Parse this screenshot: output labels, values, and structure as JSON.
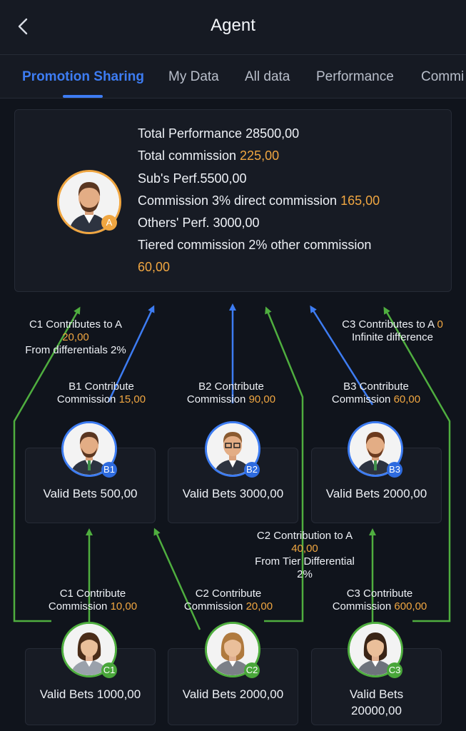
{
  "header": {
    "title": "Agent"
  },
  "tabs": [
    "Promotion Sharing",
    "My Data",
    "All data",
    "Performance",
    "Commi"
  ],
  "summary": {
    "total_performance": "Total Performance 28500,00",
    "total_commission_label": "Total commission ",
    "total_commission_value": "225,00",
    "subs_perf": "Sub's Perf.5500,00",
    "commission_direct_label": "Commission 3% direct commission ",
    "commission_direct_value": "165,00",
    "others_perf": "Others' Perf. 3000,00",
    "tiered_label": "Tiered commission 2% other commission",
    "tiered_value": "60,00",
    "badge": "A"
  },
  "notes": {
    "c1_to_a_line1": "C1 Contributes to A",
    "c1_to_a_value": "20,00",
    "c1_to_a_line3": "From differentials 2%",
    "c3_to_a_label": "C3 Contributes to A ",
    "c3_to_a_value": "0",
    "c3_to_a_line2": "Infinite difference",
    "c2_to_a_line1": "C2 Contribution to A",
    "c2_to_a_value": "40,00",
    "c2_to_a_line3": "From Tier Differential",
    "c2_to_a_line4": "2%"
  },
  "b_level": [
    {
      "badge": "B1",
      "contrib_title": "B1 Contribute",
      "contrib_label": "Commission ",
      "contrib_value": "15,00",
      "valid_bets": "Valid Bets 500,00"
    },
    {
      "badge": "B2",
      "contrib_title": "B2 Contribute",
      "contrib_label": "Commission ",
      "contrib_value": "90,00",
      "valid_bets": "Valid Bets 3000,00"
    },
    {
      "badge": "B3",
      "contrib_title": "B3 Contribute",
      "contrib_label": "Commission ",
      "contrib_value": "60,00",
      "valid_bets": "Valid Bets 2000,00"
    }
  ],
  "c_level": [
    {
      "badge": "C1",
      "contrib_title": "C1 Contribute",
      "contrib_label": "Commission ",
      "contrib_value": "10,00",
      "valid_bets_1": "Valid Bets 1000,00",
      "valid_bets_2": ""
    },
    {
      "badge": "C2",
      "contrib_title": "C2 Contribute",
      "contrib_label": "Commission ",
      "contrib_value": "20,00",
      "valid_bets_1": "Valid Bets 2000,00",
      "valid_bets_2": ""
    },
    {
      "badge": "C3",
      "contrib_title": "C3 Contribute",
      "contrib_label": "Commission ",
      "contrib_value": "600,00",
      "valid_bets_1": "Valid Bets",
      "valid_bets_2": "20000,00"
    }
  ],
  "colors": {
    "accent_blue": "#3d7cf2",
    "accent_orange": "#f0a641",
    "accent_green": "#4fae3f",
    "background": "#10141c"
  }
}
